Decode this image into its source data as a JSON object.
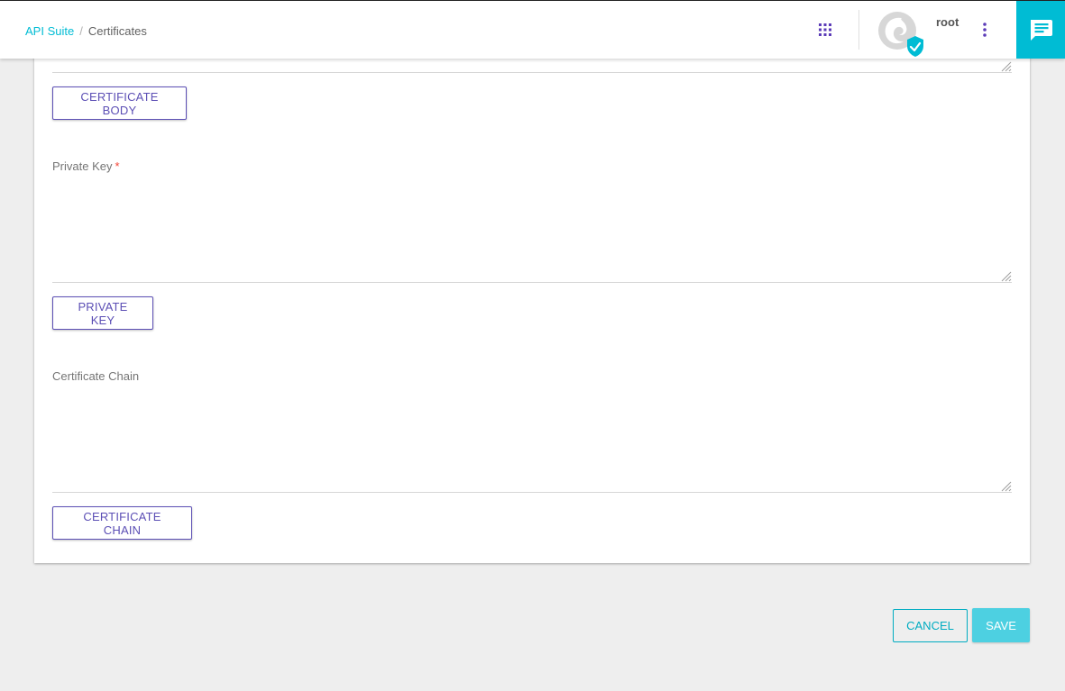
{
  "breadcrumb": {
    "items": [
      {
        "label": "API Suite",
        "link": true
      },
      {
        "label": "Certificates",
        "link": false
      }
    ],
    "separator": "/"
  },
  "header": {
    "username": "root",
    "icons": [
      "apps-grid-icon",
      "avatar-icon",
      "verified-badge-icon",
      "more-vert-icon",
      "chat-icon"
    ],
    "accent_color": "#00bcd4",
    "primary_color": "#5c4fb5"
  },
  "form": {
    "certificate_body_button": "CERTIFICATE BODY",
    "private_key": {
      "label": "Private Key",
      "required_marker": "*",
      "value": "",
      "button": "PRIVATE KEY"
    },
    "certificate_chain": {
      "label": "Certificate Chain",
      "value": "",
      "button": "CERTIFICATE CHAIN"
    }
  },
  "actions": {
    "cancel": "CANCEL",
    "save": "SAVE"
  }
}
